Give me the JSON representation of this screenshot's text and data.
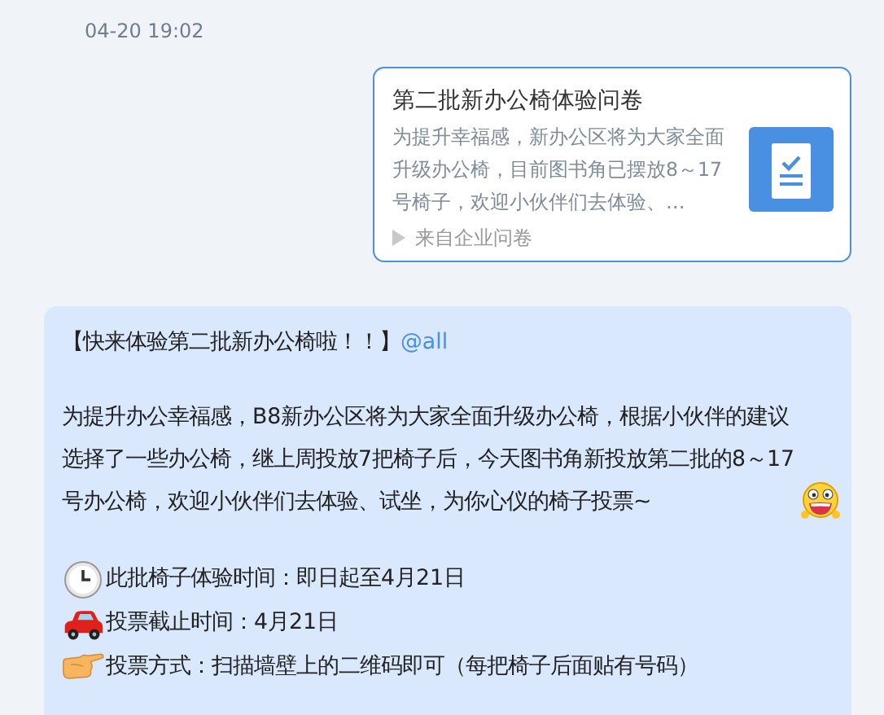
{
  "timestamp": "04-20 19:02",
  "card": {
    "title": "第二批新办公椅体验问卷",
    "description": "为提升幸福感，新办公区将为大家全面升级办公椅，目前图书角已摆放8～17号椅子，欢迎小伙伴们去体验、…",
    "source": "来自企业问卷"
  },
  "message": {
    "headline": "【快来体验第二批新办公椅啦！！】",
    "mention": "@all",
    "paragraph": "为提升办公幸福感，B8新办公区将为大家全面升级办公椅，根据小伙伴的建议选择了一些办公椅，继上周投放7把椅子后，今天图书角新投放第二批的8～17号办公椅，欢迎小伙伴们去体验、试坐，为你心仪的椅子投票~",
    "items": [
      {
        "kind": "clock",
        "text": "此批椅子体验时间：即日起至4月21日"
      },
      {
        "kind": "car",
        "text": "投票截止时间：4月21日"
      },
      {
        "kind": "hand",
        "text": "投票方式：扫描墙壁上的二维码即可（每把椅子后面贴有号码）"
      }
    ]
  }
}
